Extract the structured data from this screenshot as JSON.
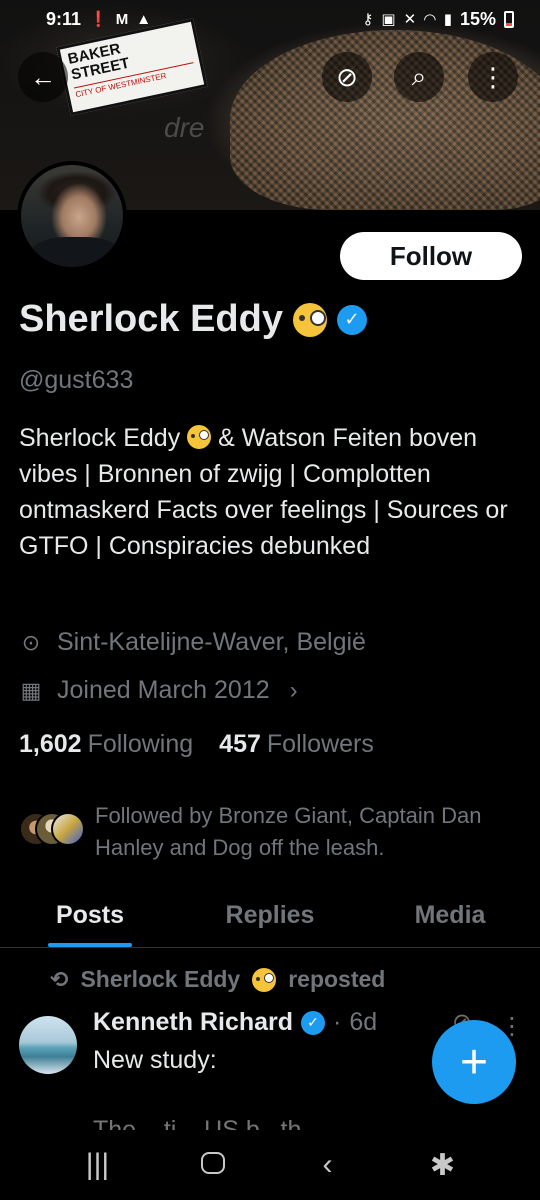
{
  "status_bar": {
    "time": "9:11",
    "left_icons": [
      "shield-alert-icon",
      "gmail-icon",
      "app-icon"
    ],
    "right_icons": [
      "key-icon",
      "lock-icon",
      "mute-icon",
      "wifi-icon",
      "signal-icon"
    ],
    "battery_percent": "15%",
    "battery_level": 0.15
  },
  "banner": {
    "sign_line1": "BAKER",
    "sign_line2": "STREET",
    "sign_line3": "CITY OF WESTMINSTER",
    "watermark": "dre"
  },
  "header_actions": {
    "back_icon": "←",
    "grok_icon": "⊘",
    "search_icon": "⌕",
    "more_icon": "⋮"
  },
  "profile": {
    "follow_label": "Follow",
    "display_name": "Sherlock Eddy",
    "verified_mark": "✓",
    "handle": "@gust633",
    "bio_line1_a": "Sherlock Eddy",
    "bio_line1_b": "& Watson Feiten",
    "bio_rest": "boven vibes | Bronnen of zwijg | Complotten ontmaskerd Facts over feelings | Sources or GTFO | Conspiracies debunked",
    "location": "Sint-Katelijne-Waver, België",
    "joined": "Joined March 2012",
    "following_count": "1,602",
    "following_label": "Following",
    "followers_count": "457",
    "followers_label": "Followers",
    "followed_by_text": "Followed by Bronze Giant, Captain Dan Hanley and Dog off the leash."
  },
  "tabs": [
    {
      "label": "Posts",
      "active": true
    },
    {
      "label": "Replies",
      "active": false
    },
    {
      "label": "Media",
      "active": false
    }
  ],
  "post": {
    "repost_by": "Sherlock Eddy",
    "repost_suffix": "reposted",
    "author": "Kenneth Richard",
    "time": "6d",
    "dot": "·",
    "text_line1": "New study:",
    "text_faded": "The ...ti... US b...th"
  },
  "fab_label": "+",
  "nav": {
    "recents": "|||",
    "back": "‹",
    "accessibility": "✱"
  }
}
